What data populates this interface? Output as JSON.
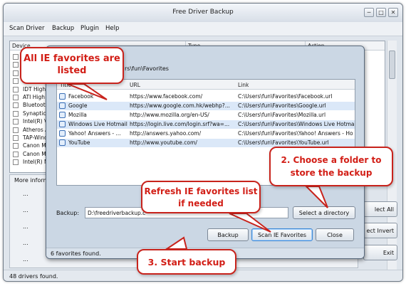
{
  "window": {
    "title": "Free Driver Backup",
    "minimize": "─",
    "maximize": "□",
    "close": "✕"
  },
  "menu": [
    "Scan Driver",
    "Backup",
    "Plugin",
    "Help"
  ],
  "drivers_table": {
    "headers": [
      "Device",
      "Type",
      "Action"
    ],
    "rows": [
      "",
      "",
      "",
      "",
      "IDT High",
      "ATI High",
      "Bluetooth",
      "Synaptics",
      "Intel(R) V",
      "Atheros A",
      "TAP-Wind",
      "Canon M",
      "Canon M",
      "Intel(R) N"
    ]
  },
  "info": {
    "title": "More inform",
    "dots": [
      "...",
      "...",
      "...",
      "...",
      "..."
    ]
  },
  "side_buttons": [
    "lect All",
    "ect Invert",
    "Exit"
  ],
  "status": "48 drivers found.",
  "dialog": {
    "path": "rs\\fun\\Favorites",
    "headers": [
      "Title",
      "URL",
      "Link"
    ],
    "favorites": [
      {
        "title": "Facebook",
        "url": "https://www.facebook.com/",
        "link": "C:\\Users\\fun\\Favorites\\Facebook.url"
      },
      {
        "title": "Google",
        "url": "https://www.google.com.hk/webhp?...",
        "link": "C:\\Users\\fun\\Favorites\\Google.url"
      },
      {
        "title": "Mozilla",
        "url": "http://www.mozilla.org/en-US/",
        "link": "C:\\Users\\fun\\Favorites\\Mozilla.url"
      },
      {
        "title": "Windows Live Hotmail",
        "url": "https://login.live.com/login.srf?wa=...",
        "link": "C:\\Users\\fun\\Favorites\\Windows Live Hotmai"
      },
      {
        "title": "Yahoo! Answers - ...",
        "url": "http://answers.yahoo.com/",
        "link": "C:\\Users\\fun\\Favorites\\Yahoo! Answers - Ho"
      },
      {
        "title": "YouTube",
        "url": "http://www.youtube.com/",
        "link": "C:\\Users\\fun\\Favorites\\YouTube.url"
      }
    ],
    "backup_label": "Backup:",
    "backup_path": "D:\\freedriverbackup.c",
    "select_dir": "Select a directory",
    "backup_btn": "Backup",
    "scan_btn": "Scan IE Favorites",
    "close_btn": "Close",
    "status": "6 favorites found."
  },
  "callouts": {
    "listed": "All IE favorites are listed",
    "folder": "2. Choose a folder to store the backup",
    "refresh": "Refresh IE favorites list if needed",
    "start": "3. Start backup"
  },
  "colors": {
    "callout_red": "#d21e16",
    "selection": "#dbe8f8",
    "accent": "#3a86d4"
  }
}
